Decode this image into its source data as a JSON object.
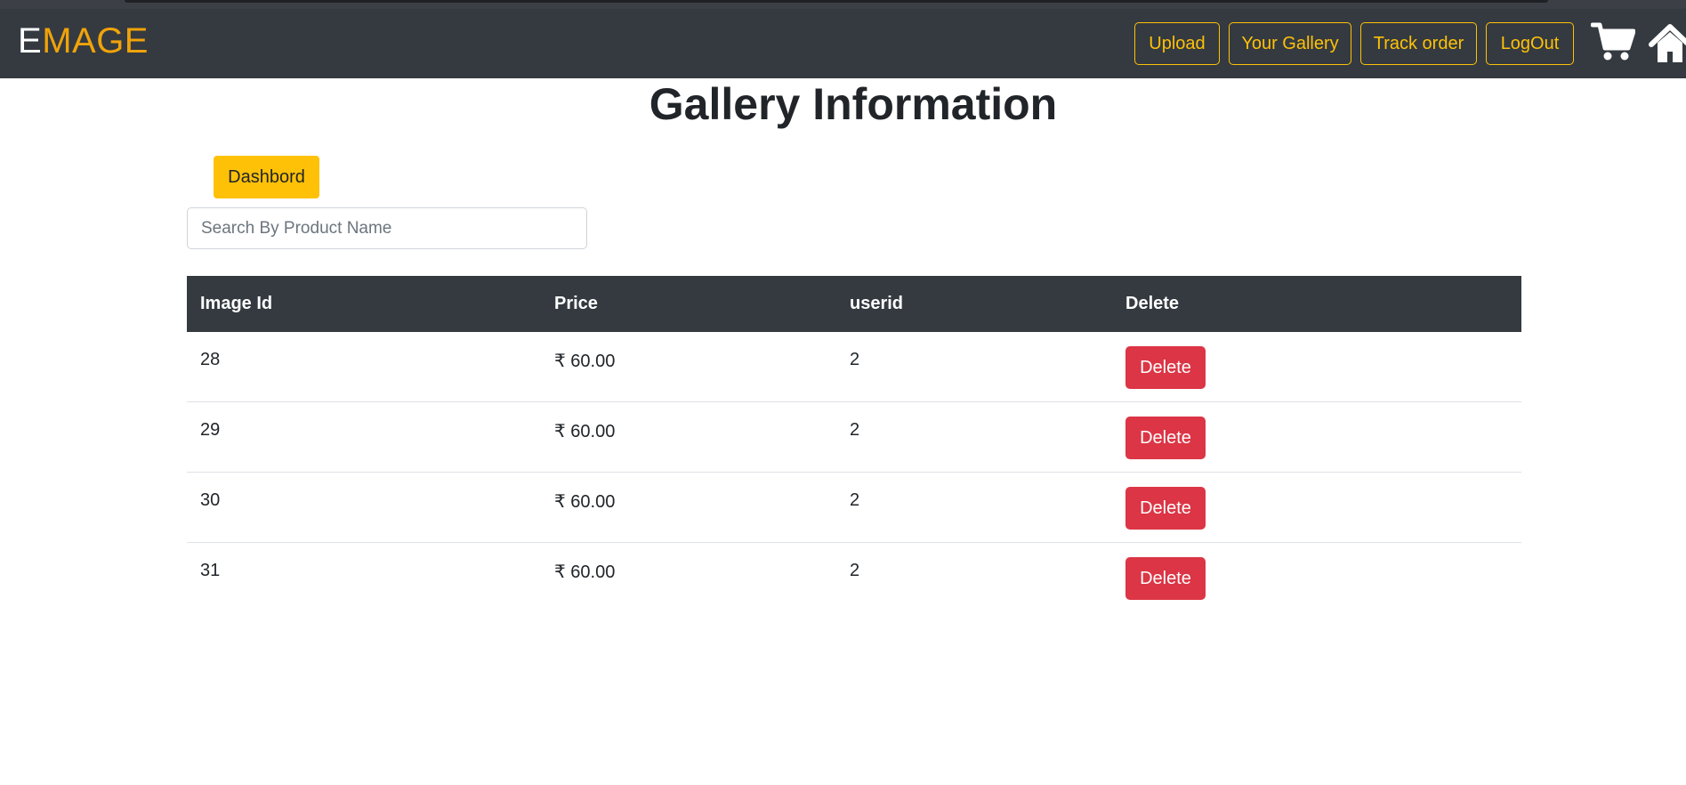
{
  "brand": {
    "first": "E",
    "rest": "MAGE"
  },
  "nav": {
    "upload": "Upload",
    "gallery": "Your Gallery",
    "track": "Track order",
    "logout": "LogOut",
    "cart_icon": "cart-icon",
    "home_icon": "home-icon"
  },
  "page": {
    "title": "Gallery Information"
  },
  "dashboard_label": "Dashbord",
  "search": {
    "placeholder": "Search By Product Name",
    "value": ""
  },
  "table": {
    "headers": [
      "Image Id",
      "Price",
      "userid",
      "Delete"
    ],
    "rows": [
      {
        "image_id": "28",
        "price": "₹ 60.00",
        "userid": "2",
        "action": "Delete"
      },
      {
        "image_id": "29",
        "price": "₹ 60.00",
        "userid": "2",
        "action": "Delete"
      },
      {
        "image_id": "30",
        "price": "₹ 60.00",
        "userid": "2",
        "action": "Delete"
      },
      {
        "image_id": "31",
        "price": "₹ 60.00",
        "userid": "2",
        "action": "Delete"
      }
    ]
  },
  "colors": {
    "navbar": "#343a40",
    "accent": "#ffc107",
    "brand_orange": "#f0a30a",
    "danger": "#dc3545"
  }
}
